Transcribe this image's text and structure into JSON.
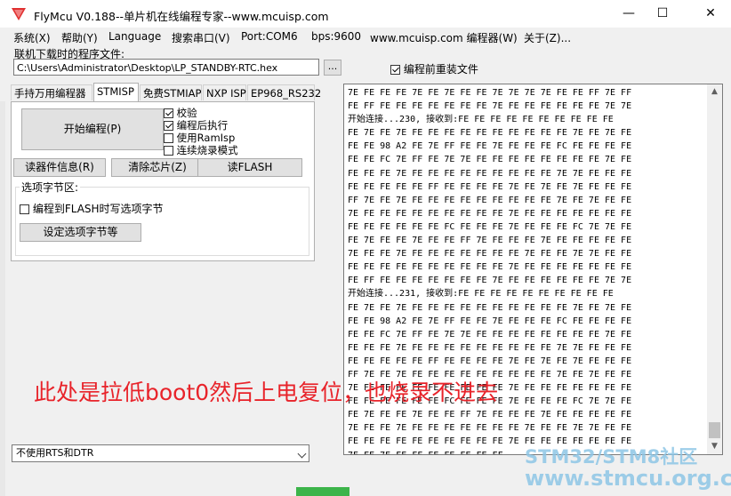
{
  "window": {
    "title": "FlyMcu V0.188--单片机在线编程专家--www.mcuisp.com",
    "minimize_glyph": "—",
    "maximize_glyph": "☐",
    "close_glyph": "✕"
  },
  "menu": {
    "items": [
      "系统(X)",
      "帮助(Y)",
      "Language",
      "搜索串口(V)",
      "Port:COM6",
      "bps:9600",
      "www.mcuisp.com 编程器(W)",
      "关于(Z)..."
    ]
  },
  "file": {
    "label": "联机下载时的程序文件:",
    "path": "C:\\Users\\Administrator\\Desktop\\LP_STANDBY-RTC.hex",
    "browse_label": "...",
    "reload_label": "编程前重装文件",
    "reload_checked": true
  },
  "tabs": [
    "手持万用编程器",
    "STMISP",
    "免费STMIAP",
    "NXP ISP",
    "EP968_RS232"
  ],
  "stmisp": {
    "start_label": "开始编程(P)",
    "options": [
      {
        "label": "校验",
        "checked": true
      },
      {
        "label": "编程后执行",
        "checked": true
      },
      {
        "label": "使用RamIsp",
        "checked": false
      },
      {
        "label": "连续烧录模式",
        "checked": false
      }
    ],
    "device_info_label": "读器件信息(R)",
    "erase_label": "清除芯片(Z)",
    "read_flash_label": "读FLASH",
    "option_group_title": "选项字节区:",
    "write_option_label": "编程到FLASH时写选项字节",
    "set_option_label": "设定选项字节等"
  },
  "rts": {
    "selected": "不使用RTS和DTR"
  },
  "log": {
    "lines": [
      "7E FE FE FE 7E FE 7E FE FE 7E 7E 7E 7E FE FE FF 7E FF",
      "FE FF FE FE FE FE FE FE FE 7E FE FE FE FE FE FE 7E 7E",
      "开始连接...230, 接收到:FE FE FE FE FE FE FE FE FE FE",
      "FE 7E FE 7E FE FE FE FE FE FE FE FE FE FE 7E FE 7E FE",
      "FE FE 98 A2 FE 7E FF FE FE 7E FE FE FE FC FE FE FE FE",
      "FE FE FC 7E FF FE 7E 7E FE FE FE FE FE FE FE FE 7E FE",
      "FE FE FE 7E FE FE FE FE FE FE FE FE FE 7E 7E FE FE FE",
      "FE FE FE FE FE FF FE FE FE FE 7E FE 7E FE 7E FE FE FE",
      "FF 7E FE 7E FE FE FE FE FE FE FE FE FE 7E FE 7E FE FE",
      "7E FE FE FE FE FE FE FE FE FE 7E FE FE FE FE FE FE FE",
      "FE FE FE FE FE FE FC FE FE FE 7E FE FE FE FC 7E 7E FE",
      "FE 7E FE FE 7E FE FE FF 7E FE FE FE 7E FE FE FE FE FE",
      "7E FE FE 7E FE FE FE FE FE FE FE 7E FE FE 7E 7E FE FE",
      "FE FE FE FE FE FE FE FE FE FE 7E FE FE FE FE FE FE FE",
      "FE FF FE FE FE FE FE FE FE 7E FE FE FE FE FE FE 7E 7E",
      "开始连接...231, 接收到:FE FE FE FE FE FE FE FE FE FE",
      "FE 7E FE 7E FE FE FE FE FE FE FE FE FE FE 7E FE 7E FE",
      "FE FE 98 A2 FE 7E FF FE FE 7E FE FE FE FC FE FE FE FE",
      "FE FE FC 7E FF FE 7E 7E FE FE FE FE FE FE FE FE 7E FE",
      "FE FE FE 7E FE FE FE FE FE FE FE FE FE 7E 7E FE FE FE",
      "FE FE FE FE FE FF FE FE FE FE 7E FE 7E FE 7E FE FE FE",
      "FF 7E FE 7E FE FE FE FE FE FE FE FE FE 7E FE 7E FE FE",
      "7E FE FE FE FE FE FE FE FE FE 7E FE FE FE FE FE FE FE",
      "FE FE FE FE FE FE FC FE FE FE 7E FE FE FE FC 7E 7E FE",
      "FE 7E FE FE 7E FE FE FF 7E FE FE FE 7E FE FE FE FE FE",
      "7E FE FE 7E FE FE FE FE FE FE FE 7E FE FE 7E 7E FE FE",
      "FE FE FE FE FE FE FE FE FE FE 7E FE FE FE FE FE FE FE",
      "7E FE 7E FE FF FE FE FE FE FF"
    ]
  },
  "annotation": {
    "text": "此处是拉低boot0然后上电复位，也烧录不进去",
    "color": "#e8232a"
  },
  "watermark": {
    "line1": "STM32/STM8社区",
    "line2": "www.stmcu.org.cn"
  }
}
